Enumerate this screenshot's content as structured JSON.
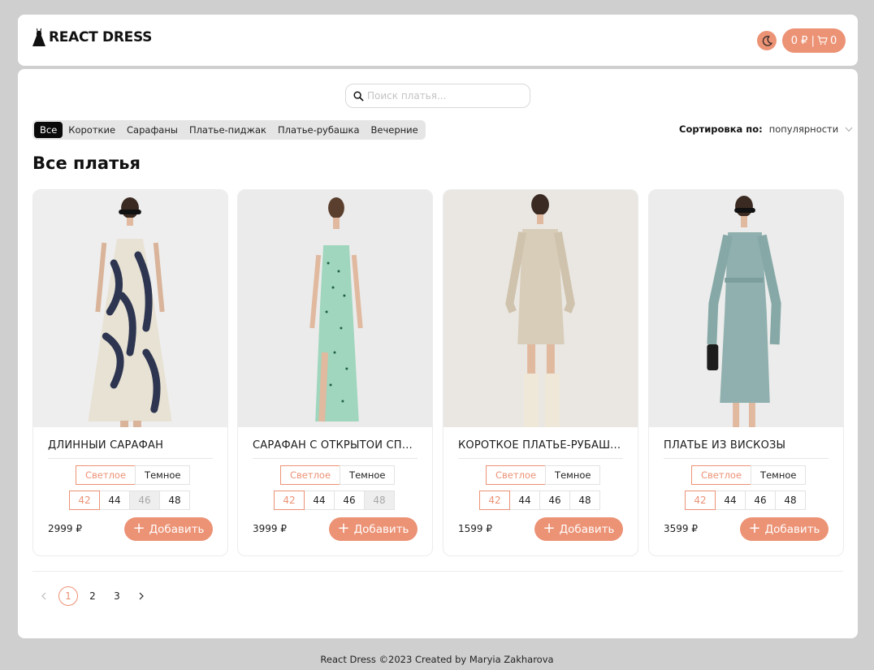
{
  "app": {
    "brand": "REACT DRESS",
    "accent": "#ec9275"
  },
  "header": {
    "theme_icon": "moon-icon",
    "cart_label": "0 ₽ |",
    "cart_count": "0",
    "cart_icon": "cart-icon"
  },
  "search": {
    "placeholder": "Поиск платья...",
    "value": ""
  },
  "categories": [
    "Все",
    "Короткие",
    "Сарафаны",
    "Платье-пиджак",
    "Платье-рубашка",
    "Вечерние"
  ],
  "categories_active": "Все",
  "sort": {
    "label": "Сортировка по:",
    "value": "популярности"
  },
  "page_title": "Все платья",
  "products": [
    {
      "title": "ДЛИННЫЙ САРАФАН",
      "tones": [
        "Светлое",
        "Темное"
      ],
      "tone_selected": "Светлое",
      "sizes": [
        "42",
        "44",
        "46",
        "48"
      ],
      "size_selected": "42",
      "size_disabled": [
        "46"
      ],
      "price": "2999 ₽",
      "add_label": "Добавить"
    },
    {
      "title": "САРАФАН С ОТКРЫТОЙ СПИ...",
      "tones": [
        "Светлое",
        "Темное"
      ],
      "tone_selected": "Светлое",
      "sizes": [
        "42",
        "44",
        "46",
        "48"
      ],
      "size_selected": "42",
      "size_disabled": [
        "48"
      ],
      "price": "3999 ₽",
      "add_label": "Добавить"
    },
    {
      "title": "КОРОТКОЕ ПЛАТЬЕ-РУБАШ...",
      "tones": [
        "Светлое",
        "Темное"
      ],
      "tone_selected": "Светлое",
      "sizes": [
        "42",
        "44",
        "46",
        "48"
      ],
      "size_selected": "42",
      "size_disabled": [],
      "price": "1599 ₽",
      "add_label": "Добавить"
    },
    {
      "title": "ПЛАТЬЕ ИЗ ВИСКОЗЫ",
      "tones": [
        "Светлое",
        "Темное"
      ],
      "tone_selected": "Светлое",
      "sizes": [
        "42",
        "44",
        "46",
        "48"
      ],
      "size_selected": "42",
      "size_disabled": [],
      "price": "3599 ₽",
      "add_label": "Добавить"
    }
  ],
  "pagination": {
    "pages": [
      "1",
      "2",
      "3"
    ],
    "current": "1"
  },
  "footer": {
    "text": "React Dress ©2023 Created by Maryia Zakharova"
  }
}
